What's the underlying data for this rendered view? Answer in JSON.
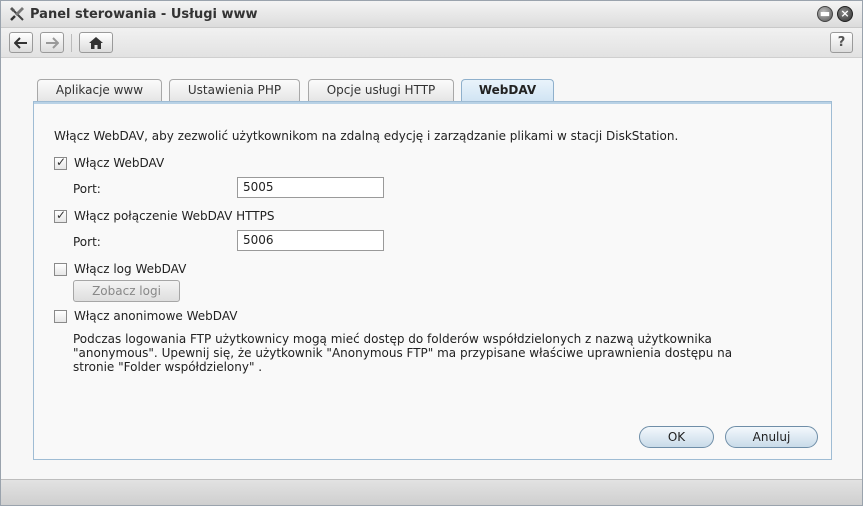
{
  "window": {
    "title": "Panel sterowania - Usługi www",
    "icons": [
      "tools-icon",
      "minimize-icon",
      "close-icon"
    ]
  },
  "toolbar": {
    "back_icon": "arrow-left-icon",
    "forward_icon": "arrow-right-icon",
    "home_icon": "home-icon",
    "help_label": "?"
  },
  "tabs": [
    {
      "label": "Aplikacje www",
      "active": false
    },
    {
      "label": "Ustawienia PHP",
      "active": false
    },
    {
      "label": "Opcje usługi HTTP",
      "active": false
    },
    {
      "label": "WebDAV",
      "active": true
    }
  ],
  "webdav": {
    "description": "Włącz WebDAV, aby zezwolić użytkownikom na zdalną edycję i zarządzanie plikami w stacji DiskStation.",
    "enable_webdav": {
      "label": "Włącz WebDAV",
      "checked": true
    },
    "port_label": "Port:",
    "port_value": "5005",
    "enable_https": {
      "label": "Włącz połączenie WebDAV HTTPS",
      "checked": true
    },
    "https_port_label": "Port:",
    "https_port_value": "5006",
    "enable_log": {
      "label": "Włącz log WebDAV",
      "checked": false
    },
    "view_logs_label": "Zobacz logi",
    "enable_anonymous": {
      "label": "Włącz anonimowe WebDAV",
      "checked": false
    },
    "anonymous_note": "Podczas logowania FTP użytkownicy mogą mieć dostęp do folderów współdzielonych z nazwą użytkownika \"anonymous\". Upewnij się, że użytkownik \"Anonymous FTP\" ma przypisane właściwe uprawnienia dostępu na stronie \"Folder współdzielony\" ."
  },
  "buttons": {
    "ok": "OK",
    "cancel": "Anuluj"
  },
  "colors": {
    "accent": "#c9dbe9",
    "tab_active": "#cfe3f3",
    "panel_border": "#9fbcd4"
  }
}
